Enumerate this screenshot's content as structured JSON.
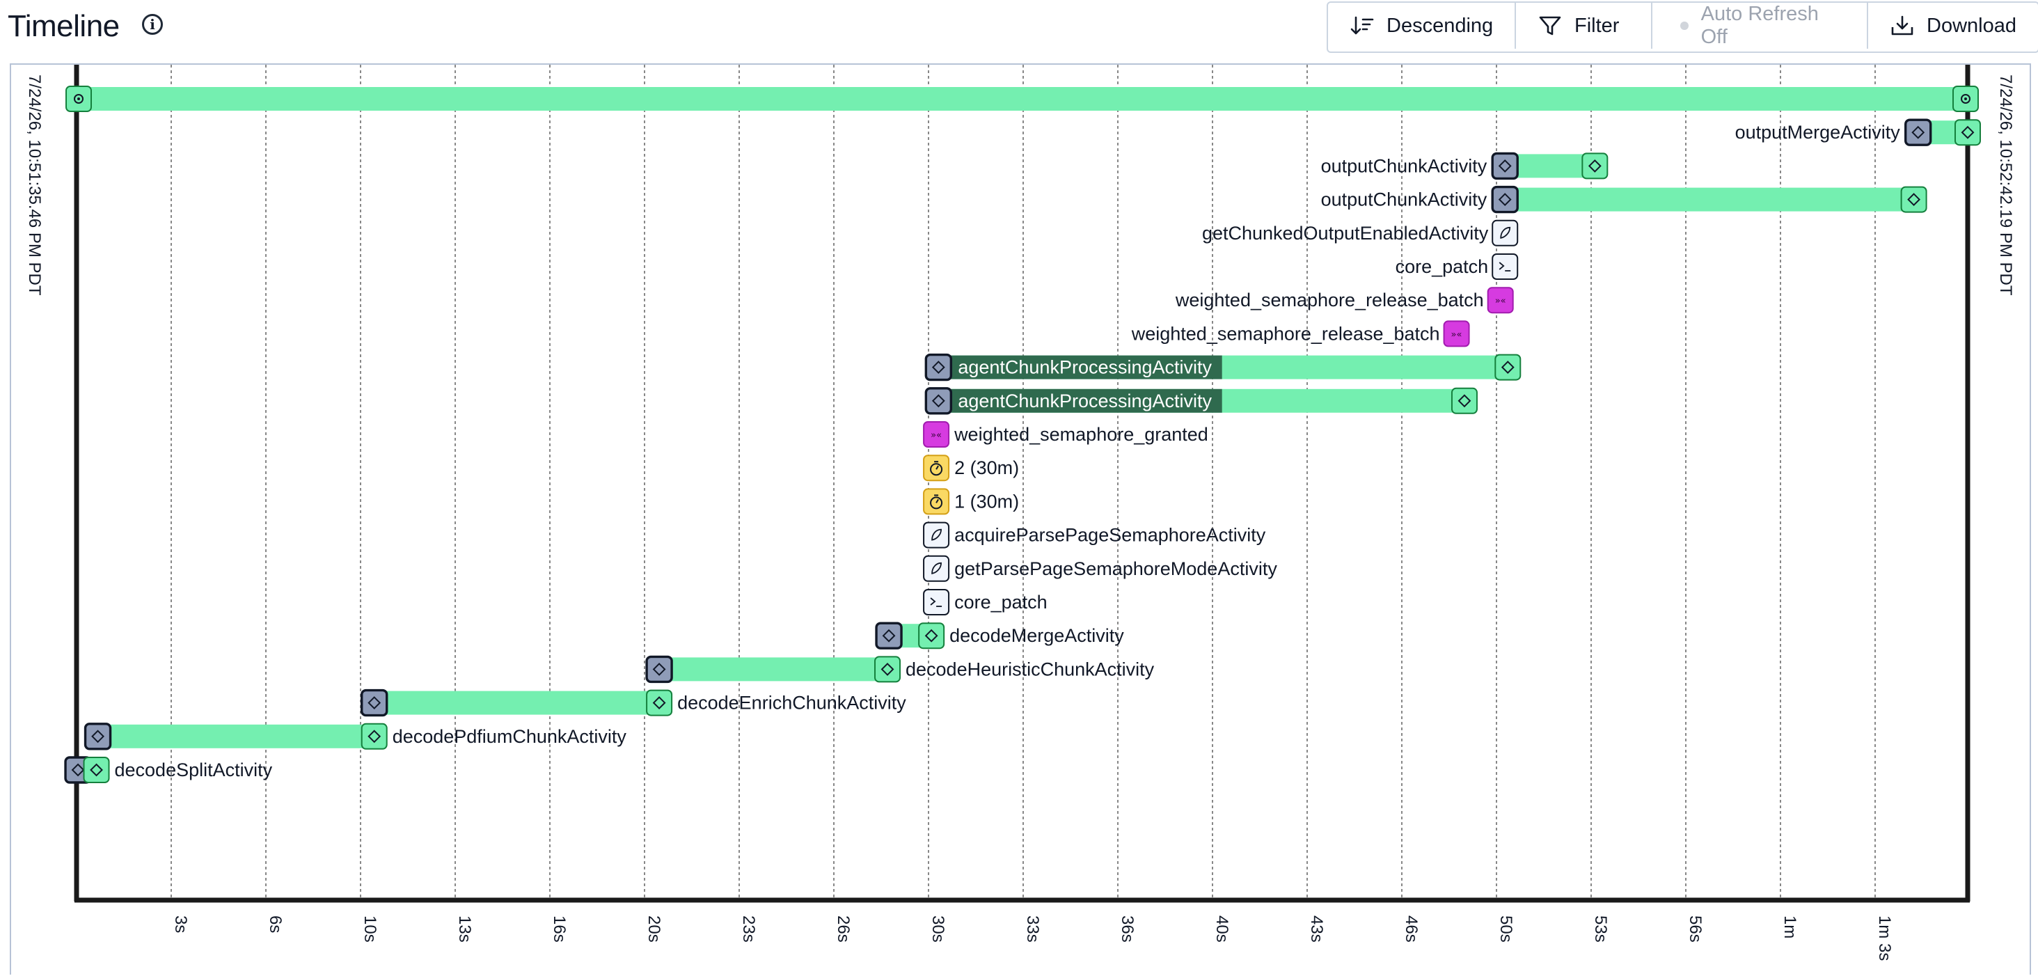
{
  "header": {
    "title": "Timeline",
    "info_icon": "info-icon"
  },
  "toolbar": {
    "descending_label": "Descending",
    "filter_label": "Filter",
    "auto_refresh_label": "Auto Refresh Off",
    "download_label": "Download"
  },
  "colors": {
    "bar": "#74efb0",
    "bar_selected": "#2f6a4e",
    "marker_start": "#8f9cb8",
    "marker_end": "#74efb0",
    "marker_signal": "#d63be0",
    "marker_timer": "#fad964",
    "marker_local": "#f1f5fc",
    "axis": "#1a1a1a"
  },
  "timeline": {
    "start_label": "7/24/26, 10:51:35.46 PM PDT",
    "end_label": "7/24/26, 10:52:42.19 PM PDT",
    "ticks": [
      "3s",
      "6s",
      "10s",
      "13s",
      "16s",
      "20s",
      "23s",
      "26s",
      "30s",
      "33s",
      "36s",
      "40s",
      "43s",
      "46s",
      "50s",
      "53s",
      "56s",
      "1m",
      "1m 3s"
    ],
    "rows": [
      {
        "label": "",
        "kind": "workflow",
        "start": 0,
        "end": 66.7
      },
      {
        "label": "outputMergeActivity",
        "kind": "activity",
        "start": 64.95,
        "end": 66.7
      },
      {
        "label": "outputChunkActivity",
        "kind": "activity",
        "start": 50.38,
        "end": 53.55
      },
      {
        "label": "outputChunkActivity",
        "kind": "activity",
        "start": 50.38,
        "end": 64.8
      },
      {
        "label": "getChunkedOutputEnabledActivity",
        "kind": "local",
        "start": 50.38
      },
      {
        "label": "core_patch",
        "kind": "patch",
        "start": 50.38
      },
      {
        "label": "weighted_semaphore_release_batch",
        "kind": "signal",
        "start": 50.22
      },
      {
        "label": "weighted_semaphore_release_batch",
        "kind": "signal",
        "start": 48.67
      },
      {
        "label": "agentChunkProcessingActivity",
        "kind": "activity",
        "start": 30.4,
        "end": 50.48,
        "selected_end": 40.4
      },
      {
        "label": "agentChunkProcessingActivity",
        "kind": "activity",
        "start": 30.4,
        "end": 48.95,
        "selected_end": 40.4
      },
      {
        "label": "weighted_semaphore_granted",
        "kind": "signal",
        "start": 30.32
      },
      {
        "label": "2 (30m)",
        "kind": "timer",
        "start": 30.32
      },
      {
        "label": "1 (30m)",
        "kind": "timer",
        "start": 30.32
      },
      {
        "label": "acquireParsePageSemaphoreActivity",
        "kind": "local",
        "start": 30.32
      },
      {
        "label": "getParsePageSemaphoreModeActivity",
        "kind": "local",
        "start": 30.32
      },
      {
        "label": "core_patch",
        "kind": "patch",
        "start": 30.32
      },
      {
        "label": "decodeMergeActivity",
        "kind": "activity",
        "start": 28.65,
        "end": 30.15
      },
      {
        "label": "decodeHeuristicChunkActivity",
        "kind": "activity",
        "start": 20.55,
        "end": 28.6
      },
      {
        "label": "decodeEnrichChunkActivity",
        "kind": "activity",
        "start": 10.5,
        "end": 20.55
      },
      {
        "label": "decodePdfiumChunkActivity",
        "kind": "activity",
        "start": 0.75,
        "end": 10.5
      },
      {
        "label": "decodeSplitActivity",
        "kind": "activity",
        "start": 0.05,
        "end": 0.7
      }
    ]
  }
}
